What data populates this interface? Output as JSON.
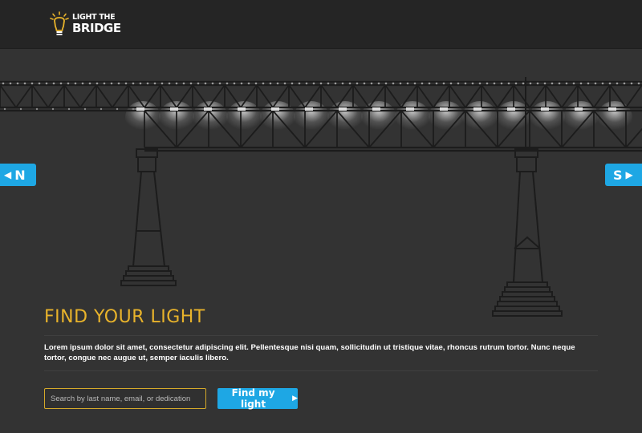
{
  "brand": {
    "logo_line1": "LIGHT THE",
    "logo_line2": "BRIDGE"
  },
  "nav": {
    "left_label": "N",
    "left_arrow": "◀",
    "right_label": "S",
    "right_arrow": "▶"
  },
  "main": {
    "title": "FIND YOUR LIGHT",
    "description": "Lorem ipsum dolor sit amet, consectetur adipiscing elit. Pellentesque nisi quam, sollicitudin ut tristique vitae, rhoncus rutrum tortor. Nunc neque tortor, congue nec augue ut, semper iaculis libero.",
    "search_placeholder": "Search by last name, email, or dedication",
    "search_value": "",
    "find_label": "Find my light",
    "find_arrow": "▶"
  },
  "colors": {
    "accent_blue": "#1ea7e4",
    "title_gold": "#e8b32b",
    "background": "#333333",
    "topbar": "#252525"
  },
  "icons": {
    "logo": "lightbulb-icon",
    "nav_left": "arrow-left-icon",
    "nav_right": "arrow-right-icon",
    "find": "arrow-right-icon"
  }
}
